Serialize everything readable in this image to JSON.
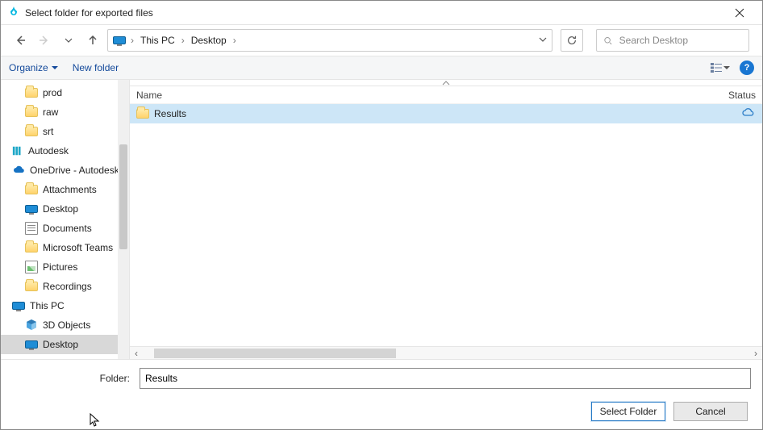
{
  "title": "Select folder for exported files",
  "nav": {
    "breadcrumbs": [
      "This PC",
      "Desktop"
    ]
  },
  "search": {
    "placeholder": "Search Desktop"
  },
  "toolbar": {
    "organize": "Organize",
    "newfolder": "New folder"
  },
  "columns": {
    "name": "Name",
    "status": "Status"
  },
  "sidebar": [
    {
      "label": "prod",
      "icon": "folder",
      "depth": 2
    },
    {
      "label": "raw",
      "icon": "folder",
      "depth": 2
    },
    {
      "label": "srt",
      "icon": "folder",
      "depth": 2
    },
    {
      "label": "Autodesk",
      "icon": "autodesk",
      "depth": 1
    },
    {
      "label": "OneDrive - Autodesk",
      "icon": "cloud",
      "depth": 1
    },
    {
      "label": "Attachments",
      "icon": "folder",
      "depth": 2
    },
    {
      "label": "Desktop",
      "icon": "monitor",
      "depth": 2
    },
    {
      "label": "Documents",
      "icon": "docs",
      "depth": 2
    },
    {
      "label": "Microsoft Teams",
      "icon": "folder",
      "depth": 2
    },
    {
      "label": "Pictures",
      "icon": "pics",
      "depth": 2
    },
    {
      "label": "Recordings",
      "icon": "folder",
      "depth": 2
    },
    {
      "label": "This PC",
      "icon": "monitor",
      "depth": 1
    },
    {
      "label": "3D Objects",
      "icon": "cube",
      "depth": 2
    },
    {
      "label": "Desktop",
      "icon": "monitor",
      "depth": 2,
      "selected": true
    }
  ],
  "rows": [
    {
      "name": "Results",
      "status": "cloud",
      "selected": true
    }
  ],
  "footer": {
    "folder_label": "Folder:",
    "folder_value": "Results",
    "select": "Select Folder",
    "cancel": "Cancel"
  }
}
